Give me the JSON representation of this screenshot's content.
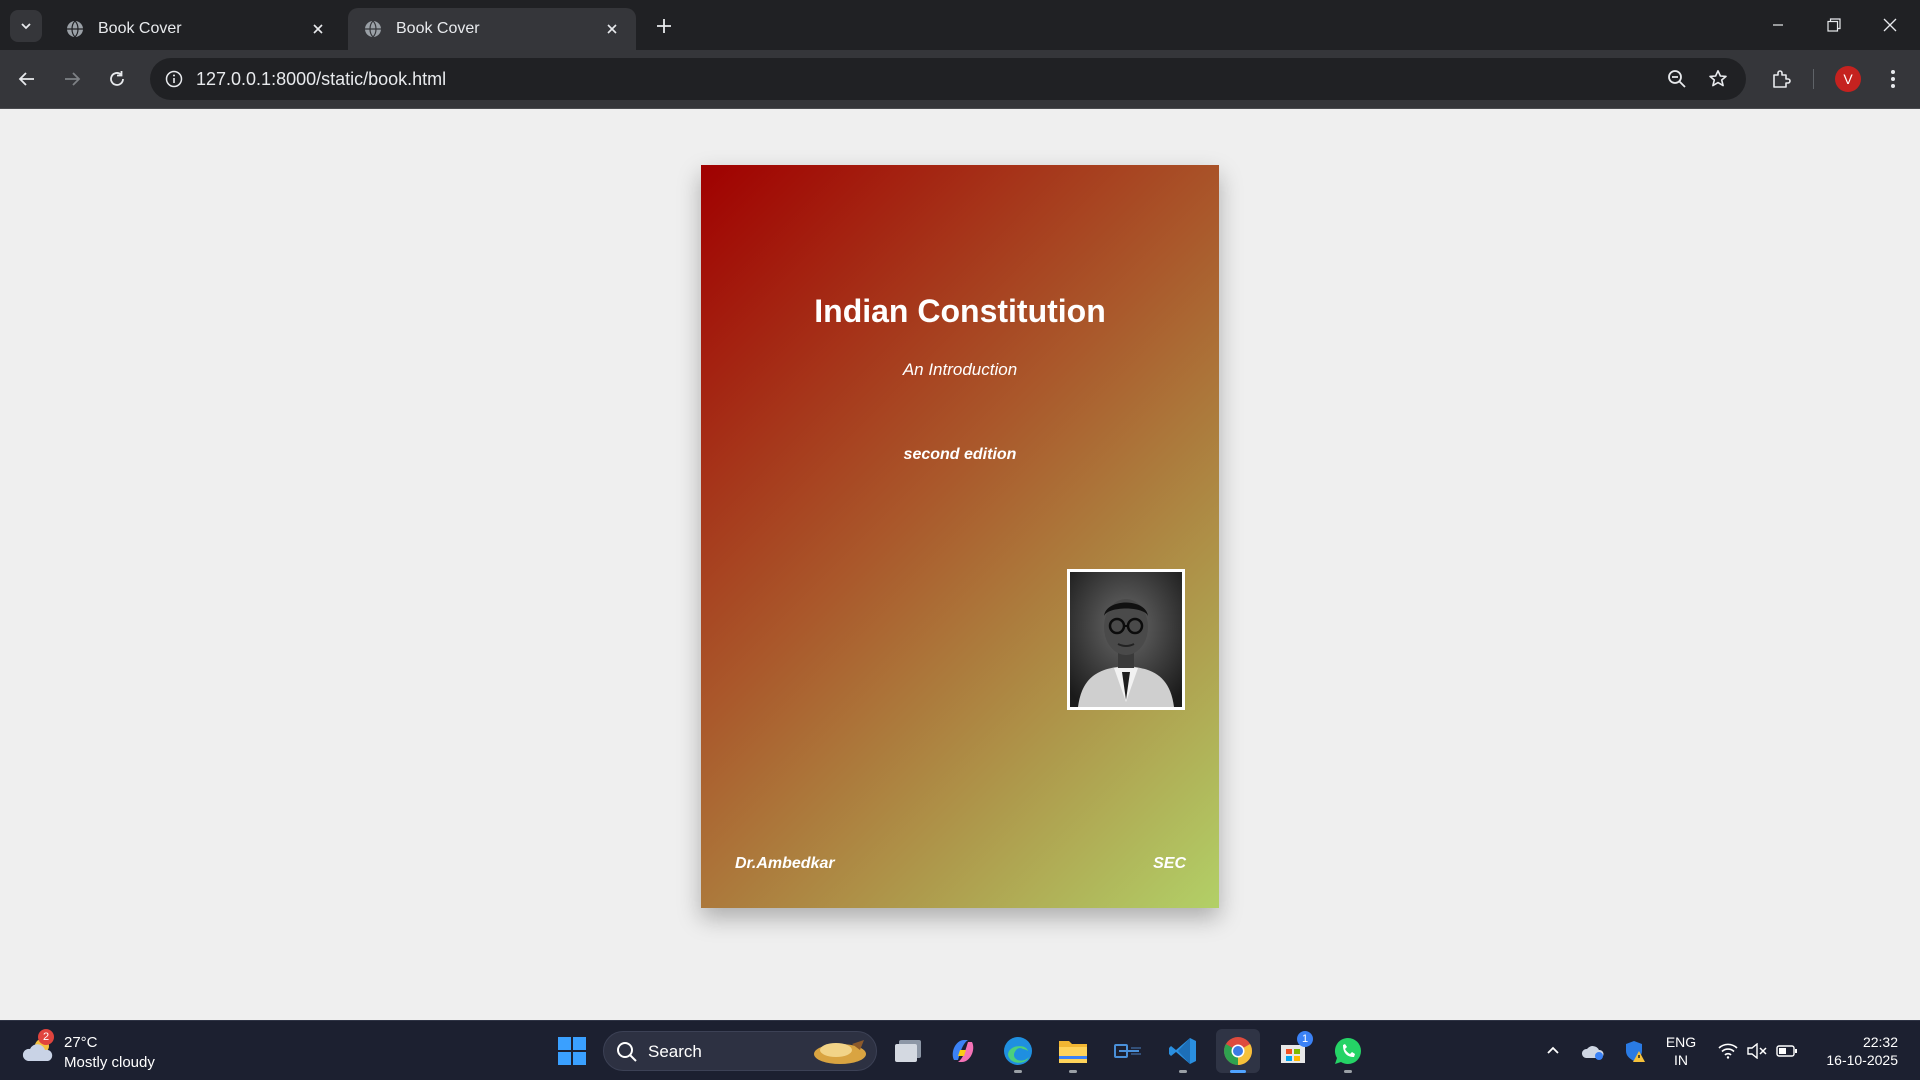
{
  "browser": {
    "tabs": [
      {
        "title": "Book Cover",
        "active": false
      },
      {
        "title": "Book Cover",
        "active": true
      }
    ],
    "url": "127.0.0.1:8000/static/book.html",
    "profile_initial": "V"
  },
  "book": {
    "title": "Indian Constitution",
    "subtitle": "An Introduction",
    "edition": "second edition",
    "author": "Dr.Ambedkar",
    "publisher": "SEC",
    "gradient_colors": [
      "#a00000",
      "#aa5a2c",
      "#b2d067"
    ]
  },
  "taskbar": {
    "weather": {
      "temp": "27°C",
      "condition": "Mostly cloudy",
      "badge": "2"
    },
    "search_label": "Search",
    "apps": [
      "task-view",
      "copilot",
      "edge",
      "file-explorer",
      "snipping-tool",
      "vscode",
      "chrome",
      "microsoft-store",
      "whatsapp"
    ],
    "store_badge": "1",
    "language": {
      "line1": "ENG",
      "line2": "IN"
    },
    "clock": {
      "time": "22:32",
      "date": "16-10-2025"
    }
  }
}
